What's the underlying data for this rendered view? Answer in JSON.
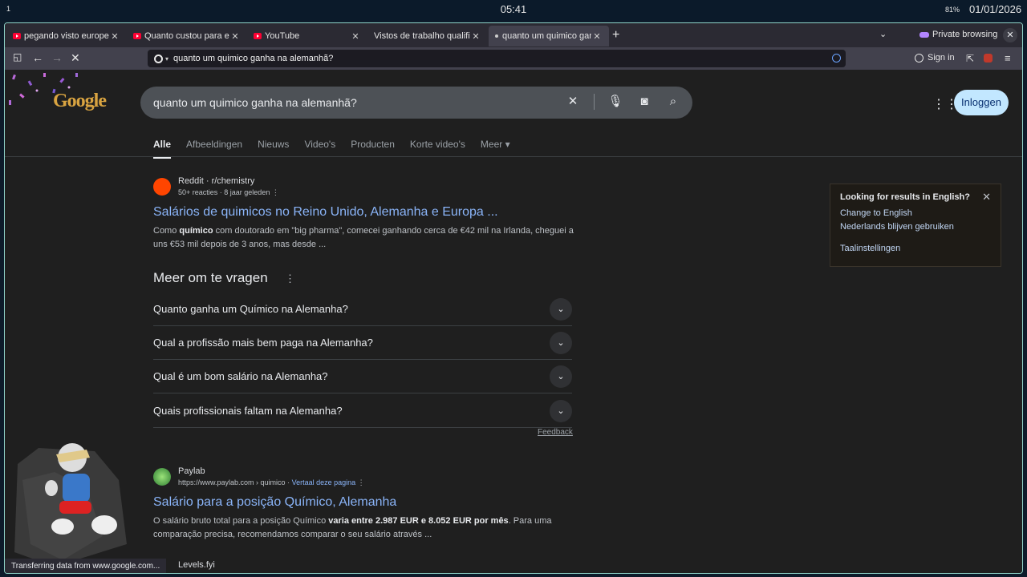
{
  "desktop": {
    "workspace": "1",
    "clock": "05:41",
    "battery": "81%",
    "date": "01/01/2026"
  },
  "tabs": [
    {
      "title": "pegando visto europeu"
    },
    {
      "title": "Quanto custou para eu tirar"
    },
    {
      "title": "YouTube"
    },
    {
      "title": "Vistos de trabalho qualificados"
    },
    {
      "title": "quanto um quimico ganha na alemanhã?"
    }
  ],
  "browser": {
    "private_label": "Private browsing",
    "url": "quanto um quimico ganha na alemanhã?",
    "signin_label": "Sign in",
    "status_text": "Transferring data from www.google.com..."
  },
  "google": {
    "logo_text": "Google",
    "query": "quanto um quimico ganha na alemanhã?",
    "login_label": "Inloggen",
    "filters": [
      "Alle",
      "Afbeeldingen",
      "Nieuws",
      "Video's",
      "Producten",
      "Korte video's",
      "Meer"
    ]
  },
  "results": [
    {
      "site": "Reddit · r/chemistry",
      "meta": "50+ reacties · 8 jaar geleden",
      "title": "Salários de quimicos no Reino Unido, Alemanha e Europa ...",
      "snippet_a": "Como ",
      "snippet_b": "químico",
      "snippet_c": " com doutorado em \"big pharma\", comecei ganhando cerca de €42 mil na Irlanda, cheguei a uns €53 mil depois de 3 anos, mas desde ..."
    },
    {
      "site": "Paylab",
      "url": "https://www.paylab.com › quimico",
      "translate": "Vertaal deze pagina",
      "title": "Salário para a posição Químico, Alemanha",
      "snippet_a": "O salário bruto total para a posição Químico ",
      "snippet_b": "varia entre 2.987 EUR e 8.052 EUR por mês",
      "snippet_c": ". Para uma comparação precisa, recomendamos comparar o seu salário através ..."
    }
  ],
  "paa": {
    "title": "Meer om te vragen",
    "questions": [
      "Quanto ganha um Químico na Alemanha?",
      "Qual a profissão mais bem paga na Alemanha?",
      "Qual é um bom salário na Alemanha?",
      "Quais profissionais faltam na Alemanha?"
    ],
    "feedback": "Feedback"
  },
  "language_box": {
    "title": "Looking for results in English?",
    "change": "Change to English",
    "keep": "Nederlands blijven gebruiken",
    "settings": "Taalinstellingen"
  },
  "next_result_site": "Levels.fyi",
  "colors": {
    "link": "#8ab4f8",
    "login_bg": "#c2e7ff",
    "window_border": "#8fd3c8"
  }
}
